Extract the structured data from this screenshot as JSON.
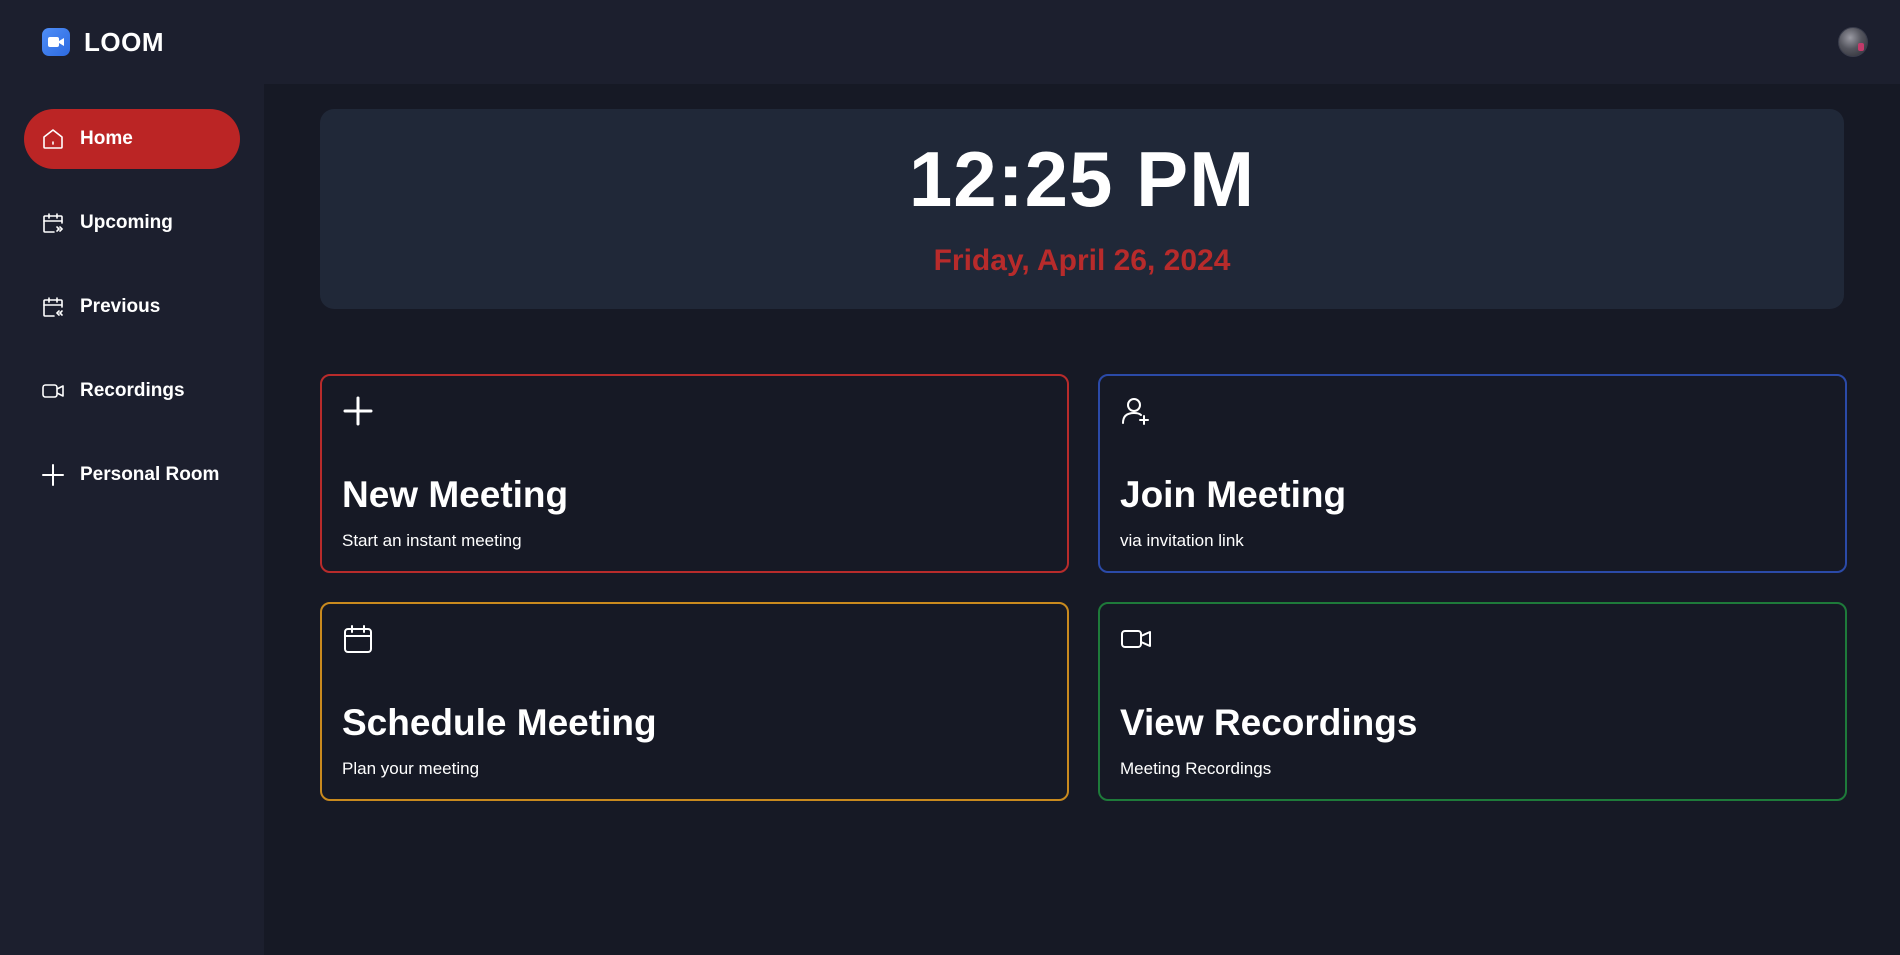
{
  "header": {
    "brand_name": "LOOM",
    "brand_icon": "video-camera-icon",
    "avatar": "user-avatar"
  },
  "sidebar": {
    "items": [
      {
        "label": "Home",
        "icon": "home-icon",
        "active": true
      },
      {
        "label": "Upcoming",
        "icon": "calendar-forward-icon",
        "active": false
      },
      {
        "label": "Previous",
        "icon": "calendar-back-icon",
        "active": false
      },
      {
        "label": "Recordings",
        "icon": "video-icon",
        "active": false
      },
      {
        "label": "Personal Room",
        "icon": "plus-icon",
        "active": false
      }
    ]
  },
  "hero": {
    "time": "12:25 PM",
    "date": "Friday, April 26, 2024"
  },
  "cards": [
    {
      "title": "New Meeting",
      "subtitle": "Start an instant meeting",
      "icon": "plus-icon",
      "border_color": "#b82b2b"
    },
    {
      "title": "Join Meeting",
      "subtitle": "via invitation link",
      "icon": "user-plus-icon",
      "border_color": "#2b4aa8"
    },
    {
      "title": "Schedule Meeting",
      "subtitle": "Plan your meeting",
      "icon": "calendar-icon",
      "border_color": "#c98a1e"
    },
    {
      "title": "View Recordings",
      "subtitle": "Meeting Recordings",
      "icon": "video-icon",
      "border_color": "#1e7a3a"
    }
  ],
  "colors": {
    "accent_red": "#bb2525",
    "background": "#161925",
    "panel": "#1c1f2e",
    "hero_panel": "#202838"
  }
}
